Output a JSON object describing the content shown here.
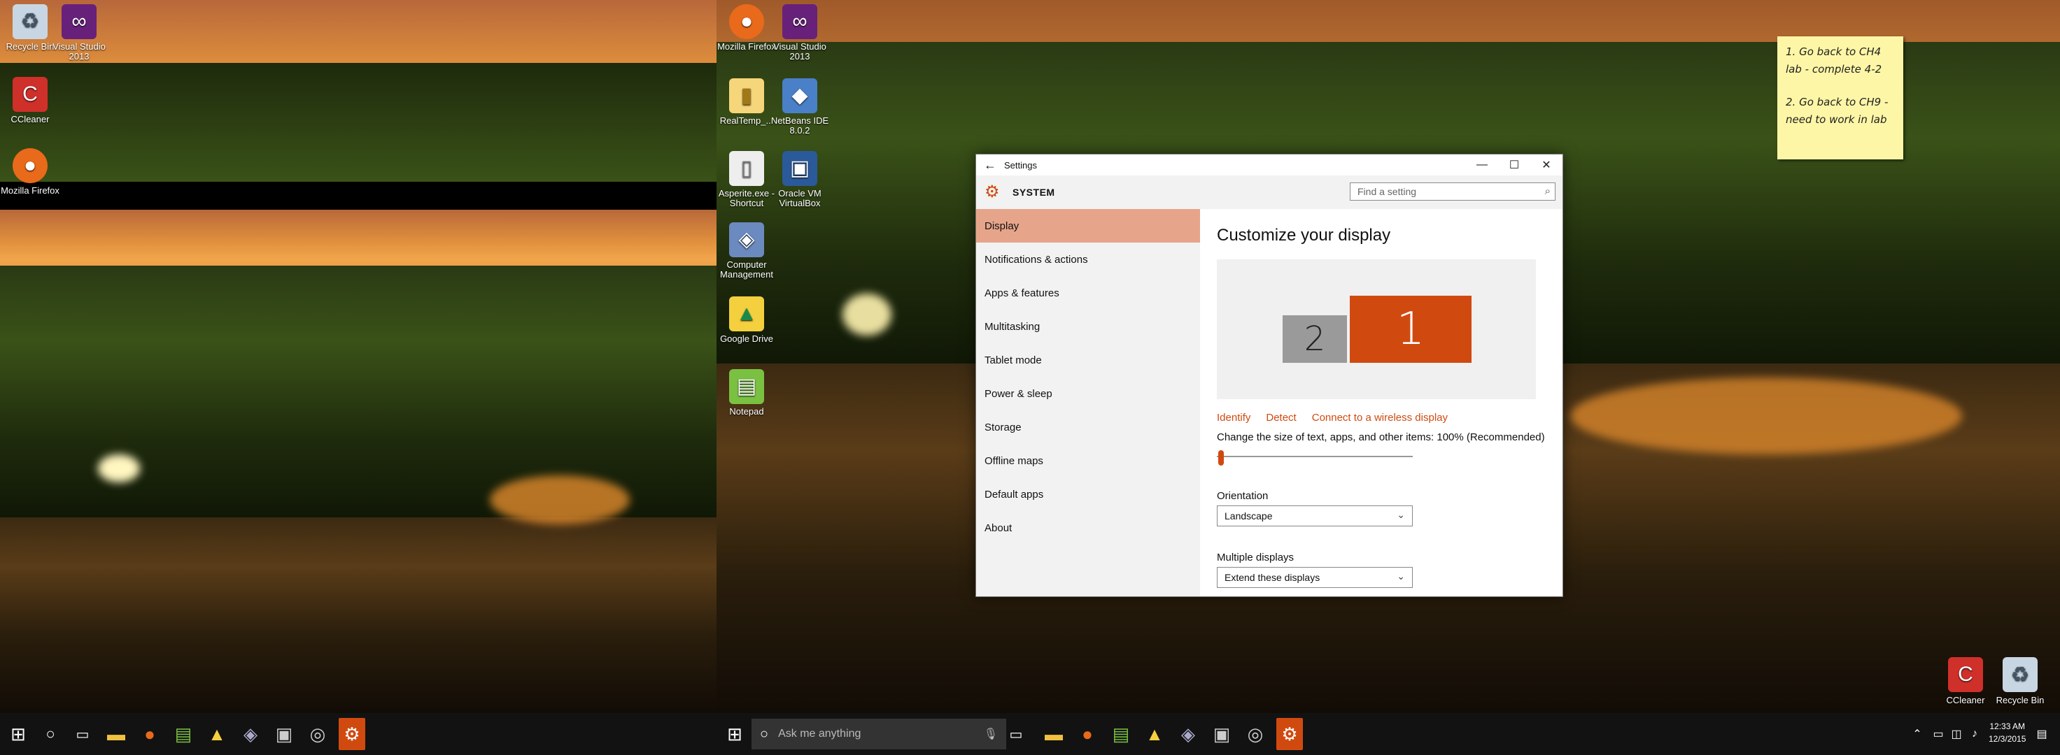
{
  "desktop_left": {
    "icons": [
      {
        "label": "Recycle Bin",
        "icon": "recycle-bin-icon"
      },
      {
        "label": "Visual Studio 2013",
        "icon": "visual-studio-icon"
      },
      {
        "label": "CCleaner",
        "icon": "ccleaner-icon"
      },
      {
        "label": "Mozilla Firefox",
        "icon": "firefox-icon"
      }
    ]
  },
  "desktop_right": {
    "icons": [
      {
        "label": "Mozilla Firefox",
        "icon": "firefox-icon"
      },
      {
        "label": "Visual Studio 2013",
        "icon": "visual-studio-icon"
      },
      {
        "label": "RealTemp_...",
        "icon": "folder-icon"
      },
      {
        "label": "NetBeans IDE 8.0.2",
        "icon": "netbeans-icon"
      },
      {
        "label": "Asperite.exe - Shortcut",
        "icon": "file-icon"
      },
      {
        "label": "Oracle VM VirtualBox",
        "icon": "virtualbox-icon"
      },
      {
        "label": "Computer Management",
        "icon": "computer-management-icon"
      },
      {
        "label": "Google Drive",
        "icon": "google-drive-icon"
      },
      {
        "label": "Notepad",
        "icon": "notepad-icon"
      }
    ],
    "corner_icons": [
      {
        "label": "CCleaner",
        "icon": "ccleaner-icon"
      },
      {
        "label": "Recycle Bin",
        "icon": "recycle-bin-icon"
      }
    ]
  },
  "sticky_note": {
    "line1": "1. Go back to CH4 lab - complete 4-2",
    "line2": "2. Go back to CH9 - need to work in lab"
  },
  "settings": {
    "window_title": "Settings",
    "header_title": "SYSTEM",
    "search_placeholder": "Find a setting",
    "nav_items": [
      {
        "label": "Display"
      },
      {
        "label": "Notifications & actions"
      },
      {
        "label": "Apps & features"
      },
      {
        "label": "Multitasking"
      },
      {
        "label": "Tablet mode"
      },
      {
        "label": "Power & sleep"
      },
      {
        "label": "Storage"
      },
      {
        "label": "Offline maps"
      },
      {
        "label": "Default apps"
      },
      {
        "label": "About"
      }
    ],
    "page_title": "Customize your display",
    "monitor1_label": "1",
    "monitor2_label": "2",
    "links": {
      "identify": "Identify",
      "detect": "Detect",
      "wireless": "Connect to a wireless display"
    },
    "scale_label": "Change the size of text, apps, and other items: 100% (Recommended)",
    "scale_value_percent": 100,
    "orientation_label": "Orientation",
    "orientation_value": "Landscape",
    "multiple_label": "Multiple displays",
    "multiple_value": "Extend these displays",
    "accent": "#d04a10"
  },
  "taskbar": {
    "search_placeholder": "Ask me anything",
    "time": "12:33 AM",
    "date": "12/3/2015"
  }
}
